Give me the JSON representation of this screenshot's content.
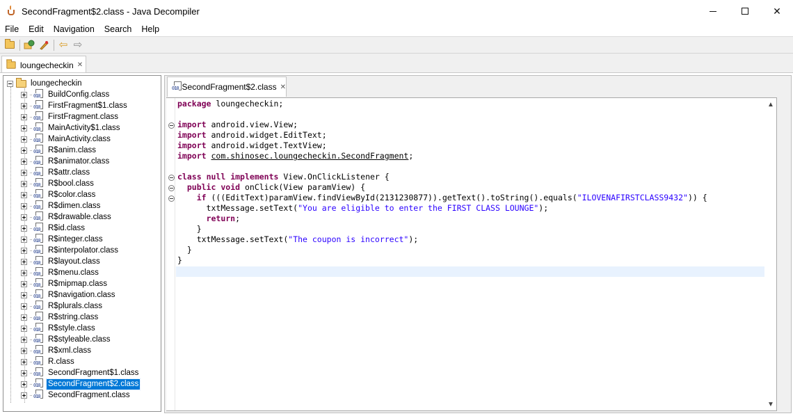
{
  "window": {
    "title": "SecondFragment$2.class - Java Decompiler",
    "controls": {
      "minimize": "—",
      "maximize": "☐",
      "close": "✕"
    }
  },
  "menu": [
    "File",
    "Edit",
    "Navigation",
    "Search",
    "Help"
  ],
  "toolbar": {
    "buttons": [
      "open-file-icon",
      "open-type-icon",
      "open-type-hierarchy-icon",
      "back-icon",
      "forward-icon"
    ]
  },
  "project_tab": {
    "label": "loungecheckin",
    "close": "✕"
  },
  "tree": {
    "root": "loungecheckin",
    "items": [
      "BuildConfig.class",
      "FirstFragment$1.class",
      "FirstFragment.class",
      "MainActivity$1.class",
      "MainActivity.class",
      "R$anim.class",
      "R$animator.class",
      "R$attr.class",
      "R$bool.class",
      "R$color.class",
      "R$dimen.class",
      "R$drawable.class",
      "R$id.class",
      "R$integer.class",
      "R$interpolator.class",
      "R$layout.class",
      "R$menu.class",
      "R$mipmap.class",
      "R$navigation.class",
      "R$plurals.class",
      "R$string.class",
      "R$style.class",
      "R$styleable.class",
      "R$xml.class",
      "R.class",
      "SecondFragment$1.class",
      "SecondFragment$2.class",
      "SecondFragment.class"
    ],
    "selected": "SecondFragment$2.class"
  },
  "editor": {
    "tab_label": "SecondFragment$2.class",
    "tab_close": "✕",
    "code": {
      "l1_kw": "package",
      "l1_rest": " loungecheckin;",
      "l2_kw": "import",
      "l2_rest": " android.view.View;",
      "l3_kw": "import",
      "l3_rest": " android.widget.EditText;",
      "l4_kw": "import",
      "l4_rest": " android.widget.TextView;",
      "l5_kw": "import",
      "l5_link": "com.shinosec.loungecheckin.SecondFragment",
      "l5_end": ";",
      "l6_kw1": "class",
      "l6_kw2": "null",
      "l6_kw3": "implements",
      "l6_rest": " View.OnClickListener {",
      "l7_kw1": "public",
      "l7_kw2": "void",
      "l7_rest": " onClick(View paramView) {",
      "l8_kw": "if",
      "l8_mid": " (((EditText)paramView.findViewById(2131230877)).getText().toString().equals(",
      "l8_str": "\"ILOVENAFIRSTCLASS9432\"",
      "l8_end": ")) {",
      "l9_pre": "txtMessage.setText(",
      "l9_str": "\"You are eligible to enter the FIRST CLASS LOUNGE\"",
      "l9_end": ");",
      "l10_kw": "return",
      "l10_end": ";",
      "l11": "}",
      "l12_pre": "txtMessage.setText(",
      "l12_str": "\"The coupon is incorrect\"",
      "l12_end": ");",
      "l13": "}",
      "l14": "}"
    }
  },
  "scrollbar": {
    "up": "▲",
    "down": "▼"
  }
}
